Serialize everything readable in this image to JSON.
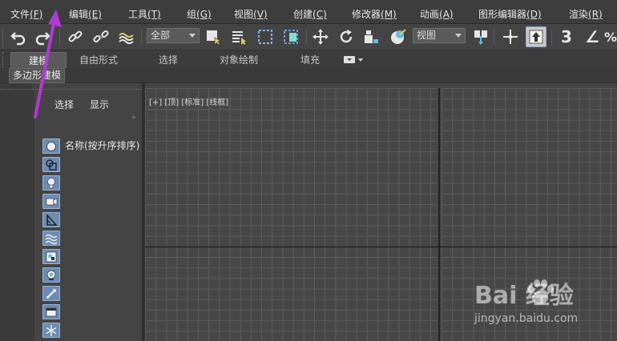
{
  "menu": [
    {
      "label": "文件",
      "key": "(F)"
    },
    {
      "label": "编辑",
      "key": "(E)"
    },
    {
      "label": "工具",
      "key": "(T)"
    },
    {
      "label": "组",
      "key": "(G)"
    },
    {
      "label": "视图",
      "key": "(V)"
    },
    {
      "label": "创建",
      "key": "(C)"
    },
    {
      "label": "修改器",
      "key": "(M)"
    },
    {
      "label": "动画",
      "key": "(A)"
    },
    {
      "label": "图形编辑器",
      "key": "(D)"
    },
    {
      "label": "渲染",
      "key": "(R)"
    }
  ],
  "toolbar": {
    "selection_filter": "全部",
    "reference_coord": "视图",
    "snap_glyph": "3",
    "angle_glyph": "∠",
    "percent_glyph": "%"
  },
  "ribbon": {
    "tabs": [
      "建模",
      "自由形式",
      "选择",
      "对象绘制",
      "填充"
    ],
    "subtab": "多边形建模"
  },
  "scene_explorer": {
    "tab_select": "选择",
    "tab_display": "显示",
    "expand_glyph": "»",
    "column_header": "名称(按升序排序)"
  },
  "filters": [
    {
      "name": "geometry"
    },
    {
      "name": "shapes"
    },
    {
      "name": "lights"
    },
    {
      "name": "cameras"
    },
    {
      "name": "helpers"
    },
    {
      "name": "space-warps"
    },
    {
      "name": "groups"
    },
    {
      "name": "xrefs"
    },
    {
      "name": "bones"
    },
    {
      "name": "containers"
    },
    {
      "name": "particles"
    }
  ],
  "viewport": {
    "label": "[+] [顶] [标准] [线框]"
  },
  "watermark": {
    "logo": "Bai  经验",
    "url": "jingyan.baidu.com"
  },
  "colors": {
    "accent_arrow": "#b13ad6",
    "filter_button": "#6d8cb4",
    "active_tool": "#c9c9c9"
  }
}
